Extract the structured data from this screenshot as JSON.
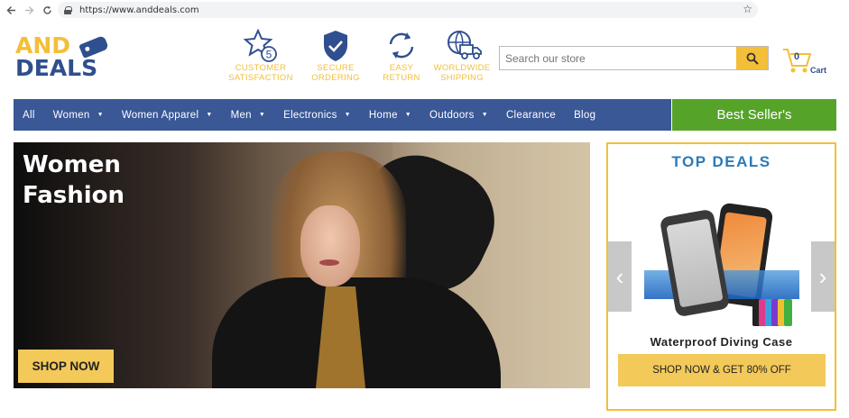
{
  "browser": {
    "url": "https://www.anddeals.com",
    "icons": [
      "back-arrow-icon",
      "forward-arrow-icon",
      "reload-icon",
      "lock-icon",
      "bookmark-star-icon"
    ]
  },
  "logo": {
    "line1": "AND",
    "line2": "DEALS"
  },
  "features": [
    {
      "line1": "CUSTOMER",
      "line2": "SATISFACTION",
      "icon": "star-5-icon"
    },
    {
      "line1": "SECURE",
      "line2": "ORDERING",
      "icon": "shield-check-icon"
    },
    {
      "line1": "EASY",
      "line2": "RETURN",
      "icon": "return-arrows-icon"
    },
    {
      "line1": "WORLDWIDE",
      "line2": "SHIPPING",
      "icon": "globe-truck-icon"
    }
  ],
  "search": {
    "placeholder": "Search our store"
  },
  "cart": {
    "count": "0",
    "label": "Cart"
  },
  "nav": {
    "items": [
      {
        "label": "All",
        "dropdown": false
      },
      {
        "label": "Women",
        "dropdown": true
      },
      {
        "label": "Women Apparel",
        "dropdown": true
      },
      {
        "label": "Men",
        "dropdown": true
      },
      {
        "label": "Electronics",
        "dropdown": true
      },
      {
        "label": "Home",
        "dropdown": true
      },
      {
        "label": "Outdoors",
        "dropdown": true
      },
      {
        "label": "Clearance",
        "dropdown": false
      },
      {
        "label": "Blog",
        "dropdown": false
      }
    ],
    "best_seller": "Best Seller's"
  },
  "hero": {
    "title_line1": "Women",
    "title_line2": "Fashion",
    "cta": "SHOP NOW"
  },
  "deals": {
    "title": "TOP DEALS",
    "product_name": "Waterproof Diving Case",
    "cta": "SHOP NOW & GET 80% OFF"
  },
  "colors": {
    "brand_blue": "#3a5796",
    "brand_yellow": "#f3bf38",
    "best_seller_green": "#56a32a",
    "deals_title_blue": "#2a7ab8"
  }
}
